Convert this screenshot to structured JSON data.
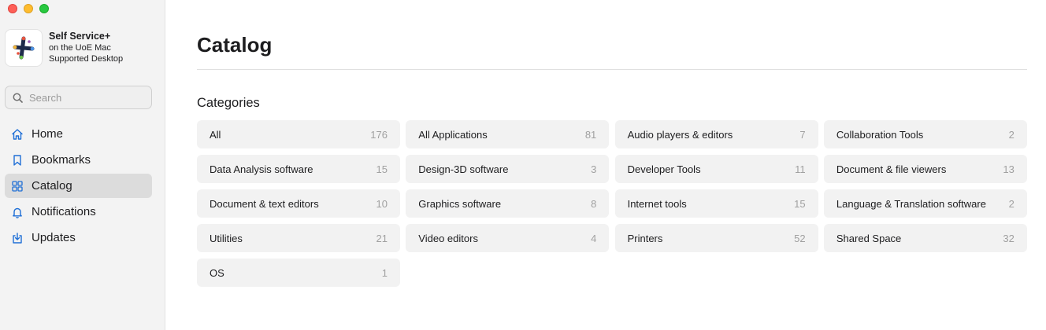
{
  "app": {
    "name": "Self Service+",
    "subtitle_line1": "on the UoE Mac",
    "subtitle_line2": "Supported Desktop"
  },
  "search": {
    "placeholder": "Search",
    "value": ""
  },
  "sidebar": {
    "items": [
      {
        "label": "Home",
        "icon": "home-icon",
        "active": false
      },
      {
        "label": "Bookmarks",
        "icon": "bookmark-icon",
        "active": false
      },
      {
        "label": "Catalog",
        "icon": "grid-icon",
        "active": true
      },
      {
        "label": "Notifications",
        "icon": "bell-icon",
        "active": false
      },
      {
        "label": "Updates",
        "icon": "download-icon",
        "active": false
      }
    ]
  },
  "main": {
    "title": "Catalog",
    "section_title": "Categories",
    "categories": [
      {
        "name": "All",
        "count": "176"
      },
      {
        "name": "All Applications",
        "count": "81"
      },
      {
        "name": "Audio players & editors",
        "count": "7"
      },
      {
        "name": "Collaboration Tools",
        "count": "2"
      },
      {
        "name": "Data Analysis software",
        "count": "15"
      },
      {
        "name": "Design-3D software",
        "count": "3"
      },
      {
        "name": "Developer Tools",
        "count": "11"
      },
      {
        "name": "Document & file viewers",
        "count": "13"
      },
      {
        "name": "Document & text editors",
        "count": "10"
      },
      {
        "name": "Graphics software",
        "count": "8"
      },
      {
        "name": "Internet tools",
        "count": "15"
      },
      {
        "name": "Language & Translation software",
        "count": "2"
      },
      {
        "name": "Utilities",
        "count": "21"
      },
      {
        "name": "Video editors",
        "count": "4"
      },
      {
        "name": "Printers",
        "count": "52"
      },
      {
        "name": "Shared Space",
        "count": "32"
      },
      {
        "name": "OS",
        "count": "1"
      }
    ]
  },
  "colors": {
    "accent": "#1f6fd6",
    "sidebar_bg": "#f3f3f3",
    "active_item_bg": "#dcdcdc",
    "tile_bg": "#f2f2f2",
    "count_text": "#a0a0a0"
  }
}
